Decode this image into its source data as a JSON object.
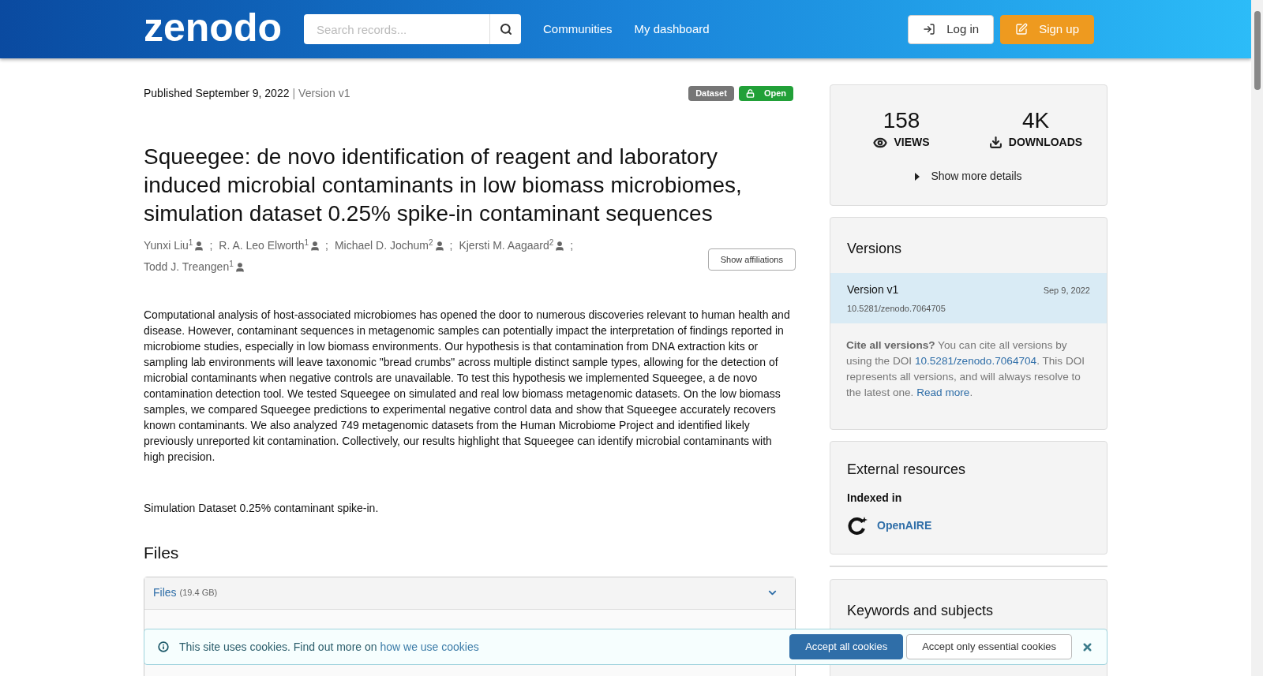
{
  "header": {
    "logo": "zenodo",
    "search": {
      "placeholder": "Search records..."
    },
    "nav": [
      "Communities",
      "My dashboard"
    ],
    "buttons": [
      {
        "label": "Log in",
        "kind": "login"
      },
      {
        "label": "Sign up",
        "kind": "signup"
      }
    ]
  },
  "record": {
    "published": "Published September 9, 2022",
    "separator": "|",
    "version": "Version v1",
    "badges": [
      {
        "label": "Dataset",
        "kind": "type"
      },
      {
        "label": "Open",
        "kind": "access"
      }
    ],
    "title": "Squeegee: de novo identification of reagent and laboratory induced microbial contaminants in low biomass microbiomes, simulation dataset 0.25% spike-in contaminant sequences",
    "creators": [
      {
        "name": "Yunxi Liu",
        "affiliation": "1"
      },
      {
        "name": "R. A. Leo Elworth",
        "affiliation": "1"
      },
      {
        "name": "Michael D. Jochum",
        "affiliation": "2"
      },
      {
        "name": "Kjersti M. Aagaard",
        "affiliation": "2"
      },
      {
        "name": "Todd J. Treangen",
        "affiliation": "1"
      }
    ],
    "creator_separator": ";",
    "show_affiliations": "Show affiliations",
    "description": "Computational analysis of host-associated microbiomes has opened the door to numerous discoveries relevant to human health and disease. However, contaminant sequences in metagenomic samples can potentially impact the interpretation of findings reported in microbiome studies, especially in low biomass environments. Our hypothesis is that contamination from DNA extraction kits or sampling lab environments will leave taxonomic \"bread crumbs\" across multiple distinct sample types, allowing for the detection of microbial contaminants when negative controls are unavailable. To test this hypothesis we implemented Squeegee, a de novo contamination detection tool. We tested Squeegee on simulated and real low biomass metagenomic datasets. On the low biomass samples, we compared Squeegee predictions to experimental negative control data and show that Squeegee accurately recovers known contaminants. We also analyzed 749 metagenomic datasets from the Human Microbiome Project and identified likely previously unreported kit contamination. Collectively, our results highlight that Squeegee can identify microbial contaminants with high precision.",
    "note": "Simulation Dataset 0.25% contaminant spike-in.",
    "files_heading": "Files",
    "files_panel": {
      "title": "Files",
      "size": "(19.4 GB)",
      "expanded": true
    }
  },
  "sidebar": {
    "stats": [
      {
        "value": "158",
        "label": "VIEWS",
        "kind": "views"
      },
      {
        "value": "4K",
        "label": "DOWNLOADS",
        "kind": "downloads"
      }
    ],
    "show_more": "Show more details",
    "versions": {
      "heading": "Versions",
      "items": [
        {
          "title": "Version v1",
          "date": "Sep 9, 2022",
          "doi": "10.5281/zenodo.7064705",
          "selected": true
        }
      ],
      "cite": {
        "bold": "Cite all versions?",
        "text1": " You can cite all versions by using the DOI ",
        "doi": "10.5281/zenodo.7064704",
        "text2": ". This DOI represents all versions, and will always resolve to the latest one. ",
        "link": "Read more",
        "end": "."
      }
    },
    "external": {
      "heading": "External resources",
      "indexed_in": "Indexed in",
      "link": "OpenAIRE"
    },
    "keywords": {
      "heading": "Keywords and subjects"
    }
  },
  "cookies": {
    "text": "This site uses cookies. Find out more on",
    "link": "how we use cookies",
    "buttons": [
      {
        "label": "Accept all cookies",
        "kind": "primary"
      },
      {
        "label": "Accept only essential cookies",
        "kind": "secondary"
      }
    ]
  }
}
